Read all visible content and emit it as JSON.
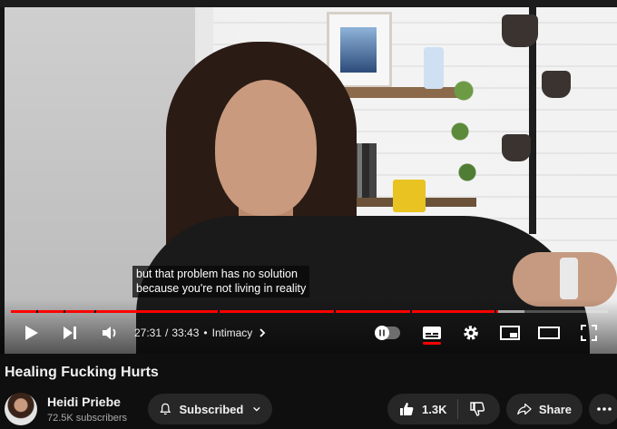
{
  "player": {
    "captions": [
      "but that problem has no solution",
      "because you're not living in reality"
    ],
    "current_time": "27:31",
    "duration": "33:43",
    "time_separator": "/",
    "chapter_dot": "•",
    "chapter": "Intimacy",
    "progress_played_fraction": 0.816,
    "progress_buffered_fraction": 0.86,
    "autoplay_on": false,
    "captions_enabled": true,
    "accent_color": "#ff0000"
  },
  "video": {
    "title": "Healing Fucking Hurts"
  },
  "channel": {
    "name": "Heidi Priebe",
    "subscribers": "72.5K subscribers"
  },
  "actions": {
    "subscribe_label": "Subscribed",
    "like_count": "1.3K",
    "share_label": "Share"
  },
  "icons": {
    "play": "play-icon",
    "next": "next-icon",
    "volume": "volume-icon",
    "chapter_chevron": "chevron-right-icon",
    "autoplay": "autoplay-toggle",
    "captions": "captions-icon",
    "settings": "gear-icon",
    "miniplayer": "miniplayer-icon",
    "theater": "theater-icon",
    "fullscreen": "fullscreen-icon",
    "bell": "bell-icon",
    "chevron_down": "chevron-down-icon",
    "like": "thumbs-up-icon",
    "dislike": "thumbs-down-icon",
    "share": "share-icon",
    "more": "more-icon"
  }
}
